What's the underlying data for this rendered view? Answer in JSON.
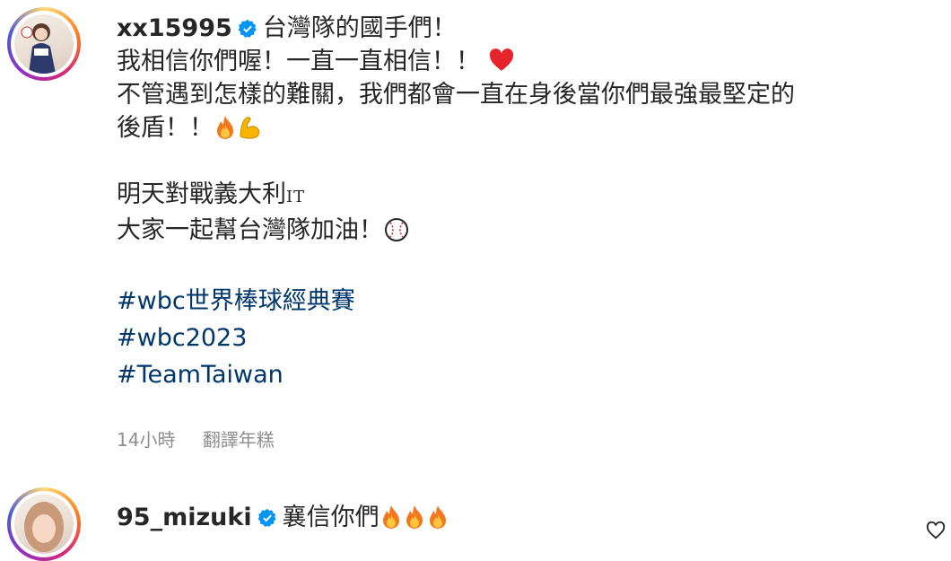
{
  "comment1": {
    "username": "xx15995",
    "first_line": "台灣隊的國手們！",
    "lines": [
      "我相信你們喔！一直一直相信！！",
      "不管遇到怎樣的難關，我們都會一直在身後當你們最強最堅定的",
      "後盾！！"
    ],
    "lines2": [
      "明天對戰義大利",
      "大家一起幫台灣隊加油！"
    ],
    "it_flag": "IT",
    "hashtags": [
      "#wbc世界棒球經典賽",
      "#wbc2023",
      "#TeamTaiwan"
    ],
    "time": "14小時",
    "translate": "翻譯年糕"
  },
  "comment2": {
    "username": "95_mizuki",
    "text": "襄信你們"
  },
  "icons": {
    "verified": "verified-badge-icon",
    "heart": "red-heart-emoji",
    "fire": "fire-emoji",
    "muscle": "flexed-biceps-emoji",
    "baseball": "baseball-emoji",
    "like": "heart-outline-icon"
  },
  "colors": {
    "verified": "#0095f6",
    "hashtag": "#00376b",
    "meta": "#8e8e8e"
  }
}
